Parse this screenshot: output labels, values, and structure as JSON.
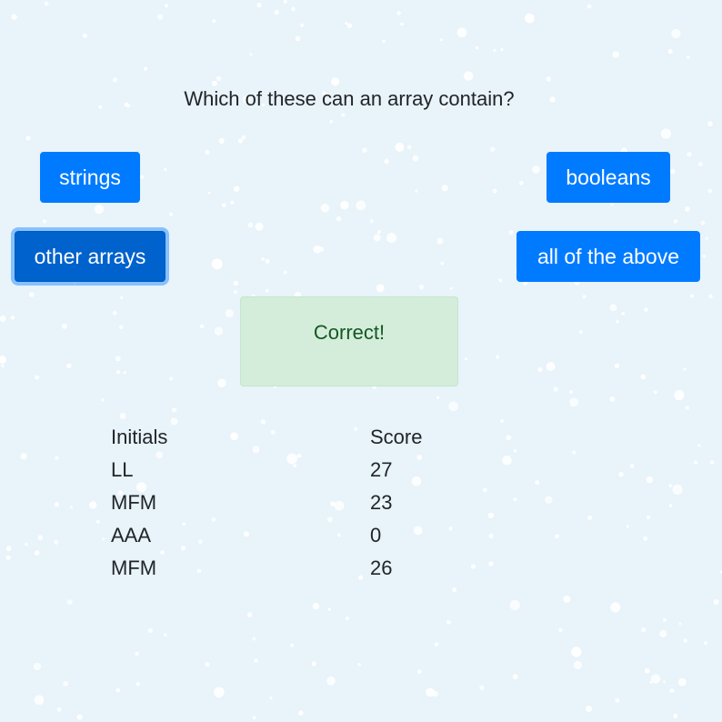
{
  "quiz": {
    "question": "Which of these can an array contain?",
    "answers": [
      "strings",
      "booleans",
      "other arrays",
      "all of the above"
    ],
    "focused_answer": "other arrays",
    "feedback": "Correct!"
  },
  "scoreboard": {
    "headers": [
      "Initials",
      "Score"
    ],
    "rows": [
      [
        "LL",
        "27"
      ],
      [
        "MFM",
        "23"
      ],
      [
        "AAA",
        "0"
      ],
      [
        "MFM",
        "26"
      ]
    ]
  },
  "colors": {
    "background": "#e8f3fa",
    "button": "#007bff",
    "button_focused": "#0062cc",
    "alert_background": "#d4edda",
    "alert_text": "#155724"
  }
}
